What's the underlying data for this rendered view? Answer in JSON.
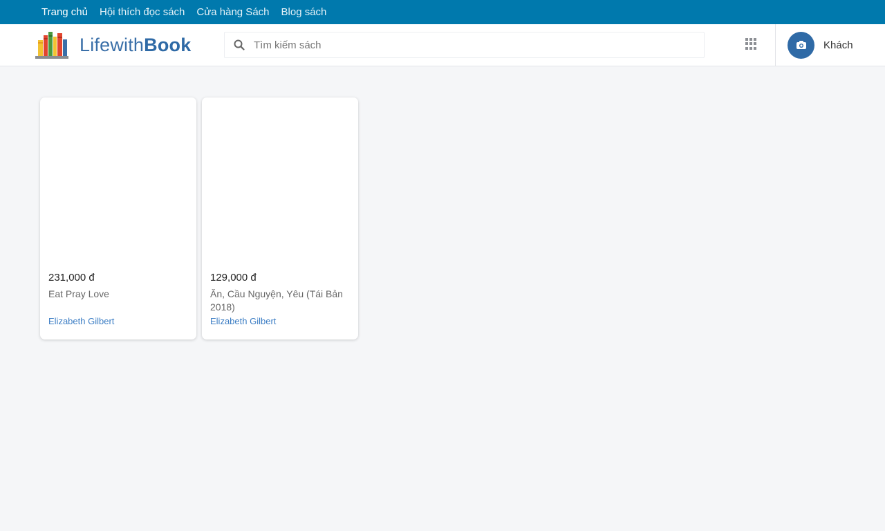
{
  "topnav": {
    "items": [
      {
        "label": "Trang chủ"
      },
      {
        "label": "Hội thích đọc sách"
      },
      {
        "label": "Cửa hàng Sách"
      },
      {
        "label": "Blog sách"
      }
    ]
  },
  "header": {
    "logo": {
      "text_light": "Lifewith",
      "text_bold": "Book"
    },
    "search": {
      "placeholder": "Tìm kiếm sách",
      "value": ""
    },
    "user": {
      "name": "Khách"
    }
  },
  "books": [
    {
      "price": "231,000 đ",
      "title": "Eat Pray Love",
      "author": "Elizabeth Gilbert"
    },
    {
      "price": "129,000 đ",
      "title": "Ăn, Cầu Nguyện, Yêu (Tái Bản 2018)",
      "author": "Elizabeth Gilbert"
    }
  ],
  "colors": {
    "topbar": "#0079ad",
    "brand": "#2f6aa6",
    "link": "#3b7dc4",
    "background": "#f5f6f8"
  },
  "icons": {
    "logo": "books-logo-icon",
    "search": "search-icon",
    "apps": "apps-grid-icon",
    "avatar": "camera-icon"
  }
}
